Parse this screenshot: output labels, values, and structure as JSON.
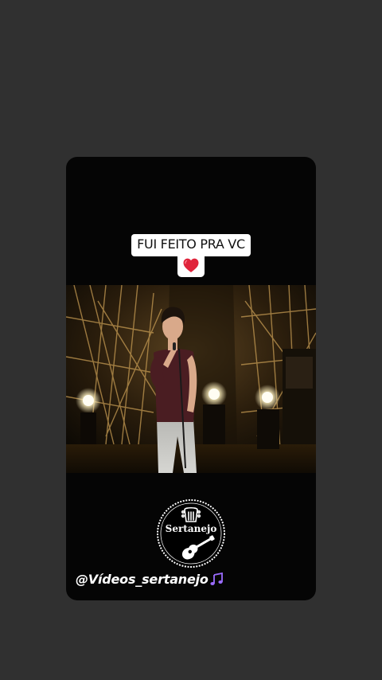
{
  "story": {
    "caption_title": "FUI FEITO PRA VC",
    "caption_emoji": "heart-icon",
    "logo_text": "Sertanejo",
    "handle": "@Vídeos_sertanejo"
  },
  "colors": {
    "background": "#303030",
    "card": "#050505",
    "caption_bg": "#ffffff",
    "heart": "#e0243b",
    "music_note": "#9b6cff"
  }
}
